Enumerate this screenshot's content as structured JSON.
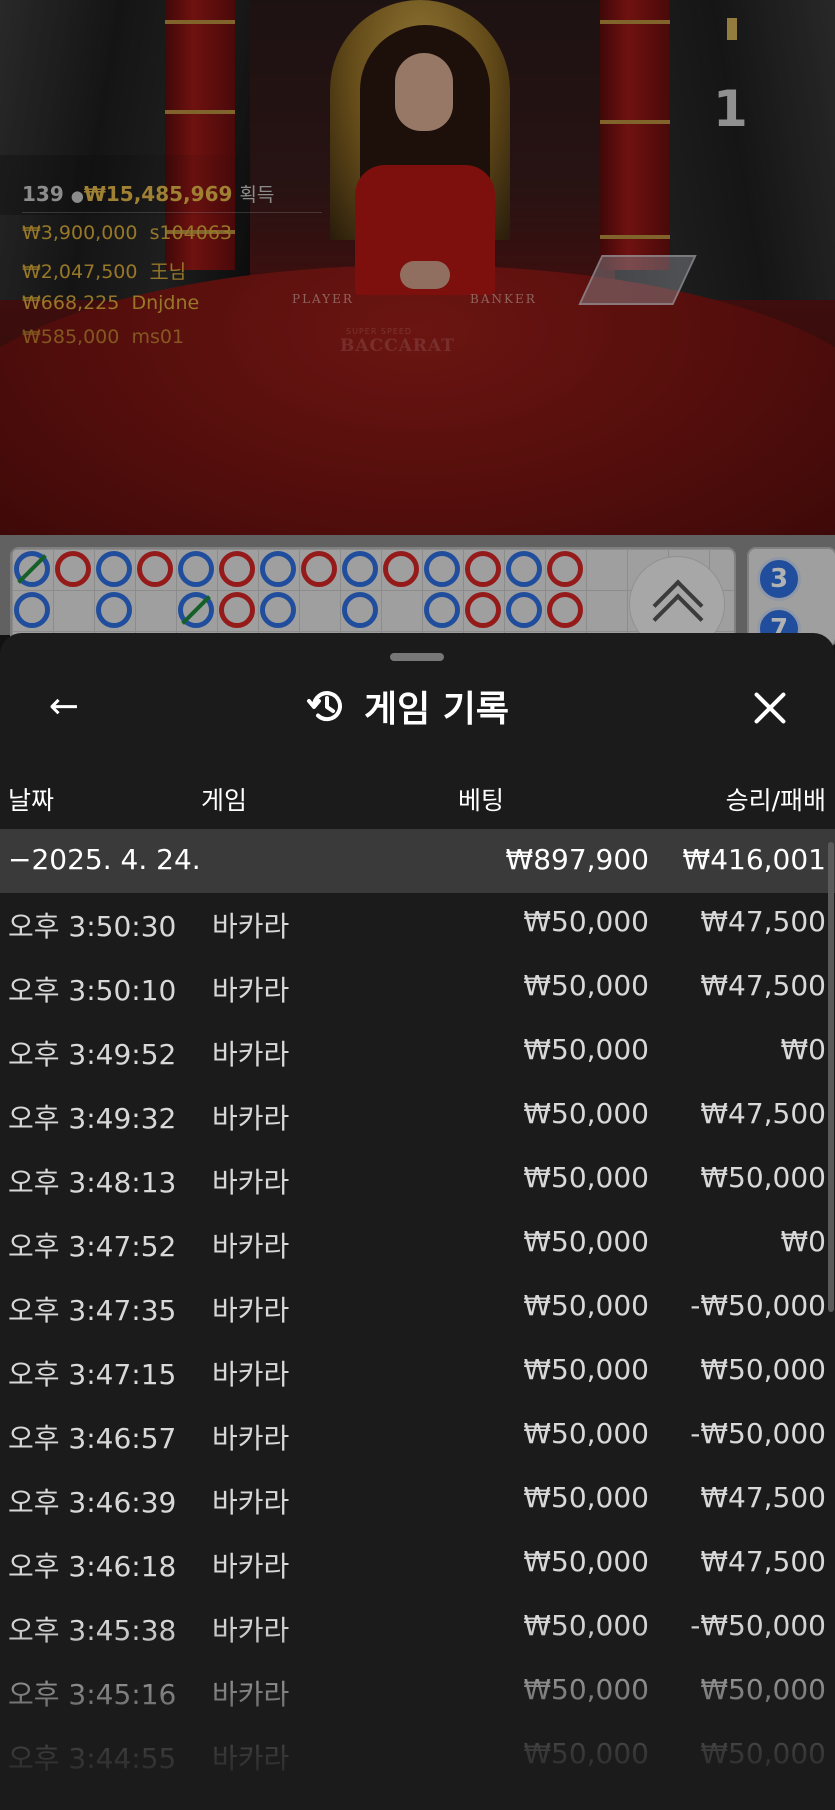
{
  "live": {
    "winners_count": "139",
    "winners_total": "₩15,485,969",
    "winners_label": "획득",
    "top_winners": [
      {
        "amount": "₩3,900,000",
        "name": "s104063"
      },
      {
        "amount": "₩2,047,500",
        "name": "王님"
      },
      {
        "amount": "₩668,225",
        "name": "Dnjdne"
      },
      {
        "amount": "₩585,000",
        "name": "ms01"
      }
    ],
    "round_number": "1",
    "felt_player": "PLAYER",
    "felt_banker": "BANKER",
    "felt_brand_small": "SUPER SPEED",
    "felt_brand": "BACCARAT"
  },
  "roadmap": {
    "side_numbers": [
      "3",
      "7"
    ]
  },
  "sheet": {
    "title": "게임 기록",
    "columns": {
      "date": "날짜",
      "game": "게임",
      "bet": "베팅",
      "result": "승리/패배"
    },
    "date_group": {
      "label": "−2025. 4. 24.",
      "bet_total": "₩897,900",
      "result_total": "₩416,001"
    },
    "rows": [
      {
        "time": "오후 3:50:30",
        "game": "바카라",
        "bet": "₩50,000",
        "result": "₩47,500"
      },
      {
        "time": "오후 3:50:10",
        "game": "바카라",
        "bet": "₩50,000",
        "result": "₩47,500"
      },
      {
        "time": "오후 3:49:52",
        "game": "바카라",
        "bet": "₩50,000",
        "result": "₩0"
      },
      {
        "time": "오후 3:49:32",
        "game": "바카라",
        "bet": "₩50,000",
        "result": "₩47,500"
      },
      {
        "time": "오후 3:48:13",
        "game": "바카라",
        "bet": "₩50,000",
        "result": "₩50,000"
      },
      {
        "time": "오후 3:47:52",
        "game": "바카라",
        "bet": "₩50,000",
        "result": "₩0"
      },
      {
        "time": "오후 3:47:35",
        "game": "바카라",
        "bet": "₩50,000",
        "result": "-₩50,000"
      },
      {
        "time": "오후 3:47:15",
        "game": "바카라",
        "bet": "₩50,000",
        "result": "₩50,000"
      },
      {
        "time": "오후 3:46:57",
        "game": "바카라",
        "bet": "₩50,000",
        "result": "-₩50,000"
      },
      {
        "time": "오후 3:46:39",
        "game": "바카라",
        "bet": "₩50,000",
        "result": "₩47,500"
      },
      {
        "time": "오후 3:46:18",
        "game": "바카라",
        "bet": "₩50,000",
        "result": "₩47,500"
      },
      {
        "time": "오후 3:45:38",
        "game": "바카라",
        "bet": "₩50,000",
        "result": "-₩50,000"
      },
      {
        "time": "오후 3:45:16",
        "game": "바카라",
        "bet": "₩50,000",
        "result": "₩50,000"
      },
      {
        "time": "오후 3:44:55",
        "game": "바카라",
        "bet": "₩50,000",
        "result": "₩50,000"
      }
    ]
  },
  "colors": {
    "banker": "#d62828",
    "player": "#2f6fe0",
    "tie": "#1f8a3a",
    "gold": "#e6b94a",
    "sheet_bg": "#1b1b1b"
  }
}
